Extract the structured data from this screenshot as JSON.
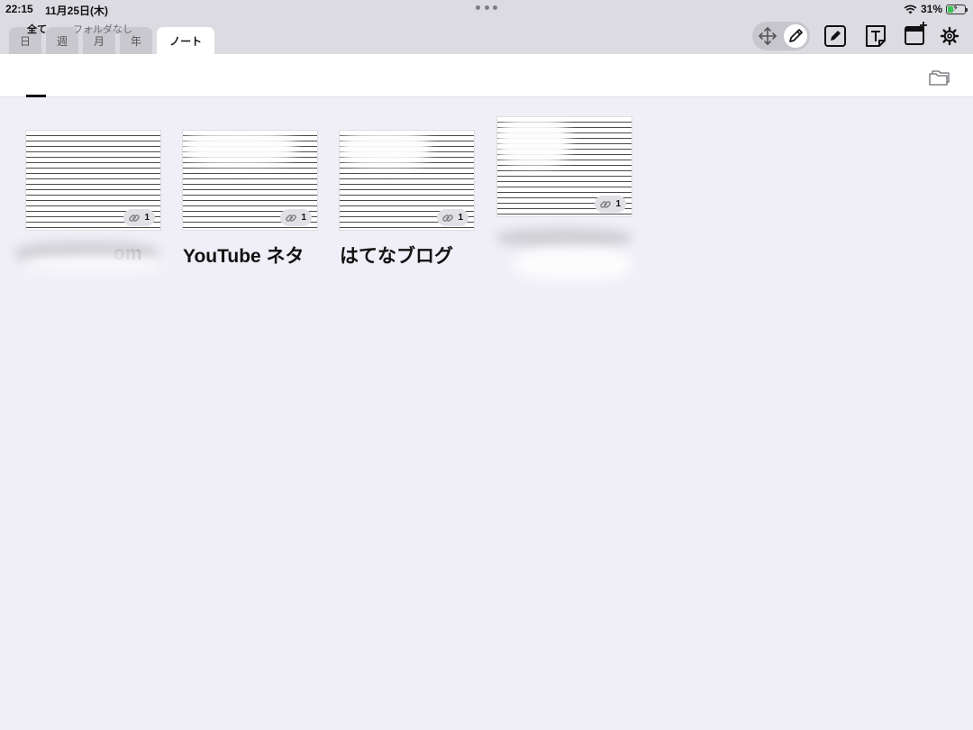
{
  "status_bar": {
    "time": "22:15",
    "date": "11月25日(木)",
    "battery": "31%",
    "battery_level": 0.31
  },
  "tabs": [
    {
      "label": "日",
      "active": false
    },
    {
      "label": "週",
      "active": false
    },
    {
      "label": "月",
      "active": false
    },
    {
      "label": "年",
      "active": false
    },
    {
      "label": "ノート",
      "active": true
    }
  ],
  "toolbar": {
    "icons": [
      "move-icon",
      "pencil-icon",
      "edit-note-icon",
      "text-icon",
      "add-calendar-icon",
      "gear-icon"
    ]
  },
  "subtabs": [
    {
      "label": "全て",
      "active": true
    },
    {
      "label": "フォルダなし",
      "active": false
    }
  ],
  "notes": [
    {
      "title": "om",
      "title_obscured": true,
      "links": "1"
    },
    {
      "title": "YouTube ネタ",
      "title_obscured": false,
      "links": "1"
    },
    {
      "title": "はてなブログ",
      "title_obscured": false,
      "links": "1"
    },
    {
      "title": "",
      "title_obscured": true,
      "links": "1"
    }
  ],
  "colors": {
    "background": "#f0eff7",
    "chrome": "#dcdbe1",
    "battery_green": "#38c552"
  }
}
